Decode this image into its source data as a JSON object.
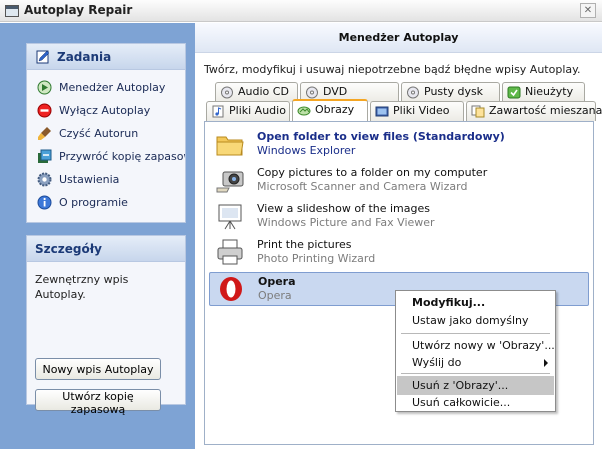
{
  "window": {
    "title": "Autoplay Repair",
    "close_label": "✕"
  },
  "left": {
    "tasks": {
      "header": "Zadania",
      "items": [
        {
          "label": "Menedżer Autoplay",
          "icon": "autoplay-manager-icon"
        },
        {
          "label": "Wyłącz Autoplay",
          "icon": "disable-icon"
        },
        {
          "label": "Czyść Autorun",
          "icon": "brush-icon"
        },
        {
          "label": "Przywróć kopię zapasową",
          "icon": "restore-icon"
        },
        {
          "label": "Ustawienia",
          "icon": "gear-icon"
        },
        {
          "label": "O programie",
          "icon": "info-icon"
        }
      ]
    },
    "details": {
      "header": "Szczegóły",
      "text": "Zewnętrzny wpis Autoplay."
    },
    "buttons": {
      "new_entry": "Nowy wpis Autoplay",
      "backup": "Utwórz kopię zapasową"
    }
  },
  "right": {
    "header": "Menedżer Autoplay",
    "description": "Twórz, modyfikuj i usuwaj niepotrzebne bądź błędne wpisy Autoplay.",
    "tabs_row1": [
      {
        "label": "Audio CD",
        "icon": "cd-icon"
      },
      {
        "label": "DVD",
        "icon": "dvd-icon"
      },
      {
        "label": "Pusty dysk",
        "icon": "disc-icon"
      },
      {
        "label": "Nieużyty",
        "icon": "unused-icon"
      }
    ],
    "tabs_row2": [
      {
        "label": "Pliki Audio",
        "icon": "audio-file-icon"
      },
      {
        "label": "Obrazy",
        "icon": "image-icon"
      },
      {
        "label": "Pliki Video",
        "icon": "video-file-icon"
      },
      {
        "label": "Zawartość mieszana",
        "icon": "mixed-content-icon"
      }
    ],
    "active_tab": "Obrazy",
    "items": [
      {
        "title": "Open folder to view files (Standardowy)",
        "subtitle": "Windows Explorer",
        "icon": "folder-icon"
      },
      {
        "title": "Copy pictures to a folder on my computer",
        "subtitle": "Microsoft Scanner and Camera Wizard",
        "icon": "camera-icon"
      },
      {
        "title": "View a slideshow of the images",
        "subtitle": "Windows Picture and Fax Viewer",
        "icon": "slideshow-icon"
      },
      {
        "title": "Print the pictures",
        "subtitle": "Photo Printing Wizard",
        "icon": "printer-icon"
      },
      {
        "title": "Opera",
        "subtitle": "Opera",
        "icon": "opera-icon"
      }
    ]
  },
  "context_menu": {
    "modify": "Modyfikuj...",
    "set_default": "Ustaw jako domyślny",
    "create_new": "Utwórz nowy w 'Obrazy'...",
    "send_to": "Wyślij do",
    "remove_from": "Usuń z 'Obrazy'...",
    "remove_all": "Usuń całkowicie..."
  }
}
